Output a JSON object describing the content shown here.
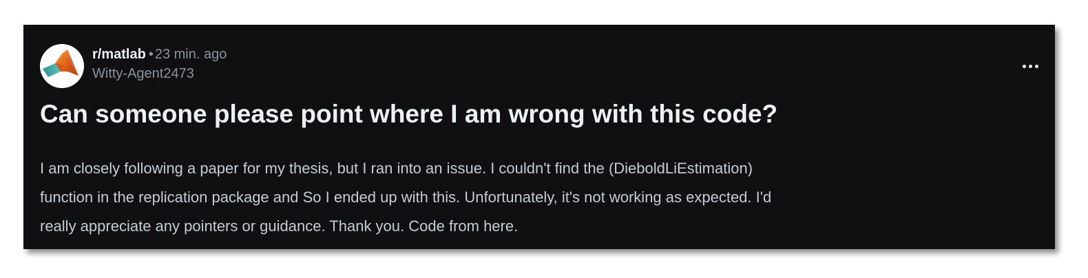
{
  "post": {
    "subreddit": "r/matlab",
    "separator": "•",
    "time": "23 min. ago",
    "author": "Witty-Agent2473",
    "avatar_icon": "matlab-logo-icon",
    "more_icon": "more-options-icon",
    "title": "Can someone please point where I am wrong with this code?",
    "body_lines": [
      "I am closely following a paper for my thesis, but I ran into an issue. I couldn't find the (DieboldLiEstimation)",
      "function in the replication package and So I ended up with this. Unfortunately, it's not working as expected. I'd",
      "really appreciate any pointers or guidance. Thank you. Code from here."
    ]
  },
  "colors": {
    "card_background": "#101012",
    "title_text": "#eef1f3",
    "body_text": "#c5ccd2",
    "muted_text": "#8b9399"
  }
}
